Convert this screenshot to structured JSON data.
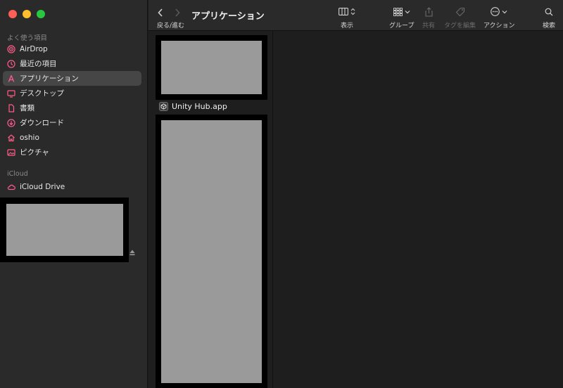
{
  "sidebar": {
    "sections": {
      "favorites": "よく使う項目",
      "icloud": "iCloud"
    },
    "items": [
      {
        "label": "AirDrop",
        "icon": "airdrop-icon"
      },
      {
        "label": "最近の項目",
        "icon": "clock-icon"
      },
      {
        "label": "アプリケーション",
        "icon": "applications-icon",
        "selected": true
      },
      {
        "label": "デスクトップ",
        "icon": "desktop-icon"
      },
      {
        "label": "書類",
        "icon": "document-icon"
      },
      {
        "label": "ダウンロード",
        "icon": "download-icon"
      },
      {
        "label": "oshio",
        "icon": "home-icon"
      },
      {
        "label": "ピクチャ",
        "icon": "pictures-icon"
      }
    ],
    "icloud_items": [
      {
        "label": "iCloud Drive",
        "icon": "cloud-icon"
      }
    ]
  },
  "toolbar": {
    "nav_label": "戻る/進む",
    "title": "アプリケーション",
    "view_label": "表示",
    "group_label": "グループ",
    "share_label": "共有",
    "tags_label": "タグを編集",
    "action_label": "アクション",
    "search_label": "検索"
  },
  "files": [
    {
      "name": "Unity Hub.app",
      "icon": "unity-hub-icon"
    }
  ],
  "colors": {
    "accent": "#ff5c8a",
    "window_bg": "#1e1e1e",
    "sidebar_bg": "#2b2a2b",
    "selection": "#464646"
  }
}
